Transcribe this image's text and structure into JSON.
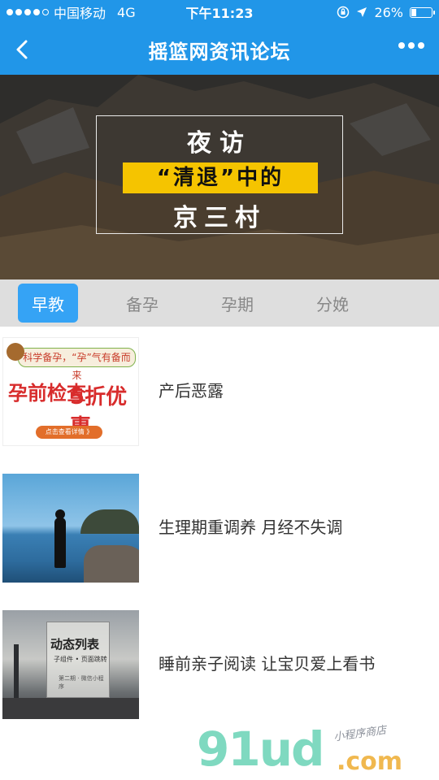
{
  "status_bar": {
    "carrier": "中国移动",
    "network": "4G",
    "time": "下午11:23",
    "battery_percent": "26%",
    "battery_level": 0.26,
    "signal_strength": 4
  },
  "nav": {
    "title": "摇篮网资讯论坛",
    "back_icon": "chevron-left-icon",
    "more_icon": "more-dots-icon"
  },
  "banner": {
    "line1": "夜访",
    "line2": "“清退”中的",
    "line3": "京三村",
    "highlight_color": "#f5c400"
  },
  "tabs": [
    {
      "label": "早教",
      "active": true
    },
    {
      "label": "备孕",
      "active": false
    },
    {
      "label": "孕期",
      "active": false
    },
    {
      "label": "分娩",
      "active": false
    }
  ],
  "articles": [
    {
      "title": "产后恶露",
      "thumb": {
        "top_text": "科学备孕，“孕”气有备而来",
        "main_text": "孕前检查",
        "badge_text": "5折优惠",
        "button_text": "点击查看详情 》"
      }
    },
    {
      "title": "生理期重调养 月经不失调"
    },
    {
      "title": "睡前亲子阅读 让宝贝爱上看书",
      "thumb": {
        "card_title": "动态列表",
        "card_sub": "子组件 • 页面跳转",
        "card_foot": "第二期 · 微信小程序"
      }
    }
  ],
  "watermark": {
    "main": "91ud",
    "domain": ".com",
    "tagline": "小程序商店"
  },
  "colors": {
    "brand_blue": "#2196e8",
    "tab_active": "#35a3f5",
    "tab_bar_bg": "#dedede"
  }
}
